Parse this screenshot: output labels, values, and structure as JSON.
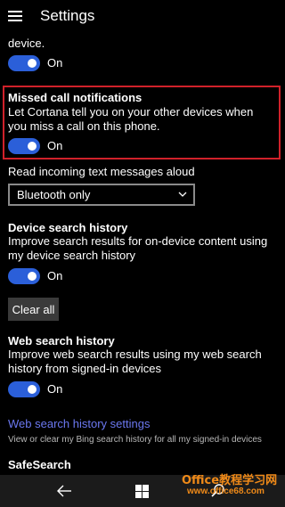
{
  "header": {
    "title": "Settings"
  },
  "top": {
    "cutoff_text": "device.",
    "toggle_state": "On"
  },
  "missed_call": {
    "title": "Missed call notifications",
    "description": "Let Cortana tell you on your other devices when you miss a call on this phone.",
    "toggle_state": "On"
  },
  "read_text": {
    "label": "Read incoming text messages aloud",
    "selected_option": "Bluetooth only"
  },
  "device_search": {
    "title": "Device search history",
    "description": "Improve search results for on-device content using my device search history",
    "toggle_state": "On",
    "clear_button": "Clear all"
  },
  "web_search": {
    "title": "Web search history",
    "description": "Improve web search results using my web search history from signed-in devices",
    "toggle_state": "On",
    "settings_link": "Web search history settings",
    "settings_sub": "View or clear my Bing search history for all my signed-in devices"
  },
  "safesearch": {
    "title": "SafeSearch"
  },
  "watermark": {
    "brand": "Office教程学习网",
    "url": "www.office68.com"
  },
  "colors": {
    "accent": "#2b5fd9",
    "link": "#6b78f0",
    "highlight": "#d0212a"
  },
  "icons": {
    "menu": "hamburger-icon",
    "back": "back-arrow-icon",
    "start": "windows-logo-icon",
    "search": "search-icon"
  }
}
